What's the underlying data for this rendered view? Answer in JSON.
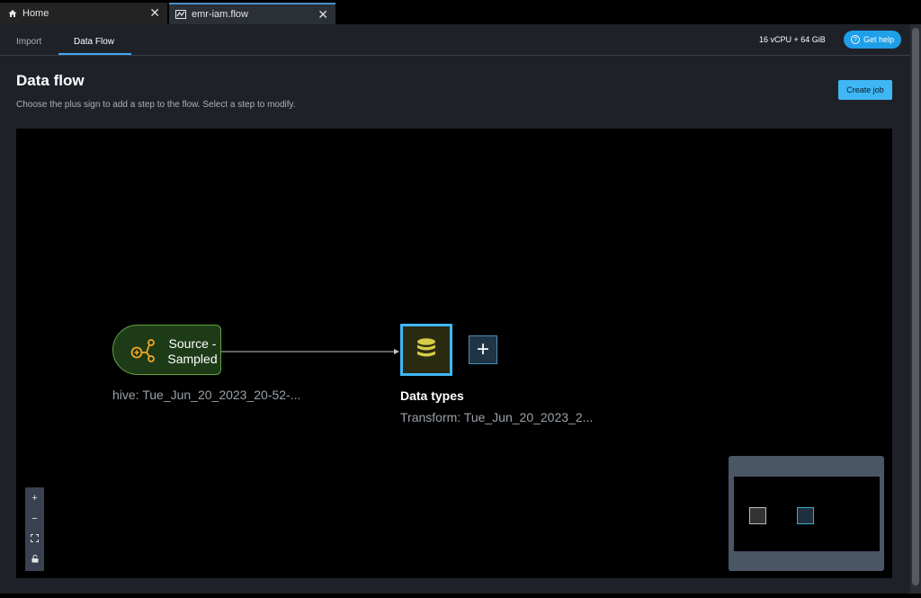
{
  "tabs": [
    {
      "label": "Home",
      "icon": "home-icon"
    },
    {
      "label": "emr-iam.flow",
      "icon": "flow-icon"
    }
  ],
  "subtabs": [
    "Import",
    "Data Flow"
  ],
  "header": {
    "resources": "16 vCPU + 64 GiB",
    "help_label": "Get help"
  },
  "page": {
    "title": "Data flow",
    "description": "Choose the plus sign to add a step to the flow. Select a step to modify.",
    "create_job_label": "Create job"
  },
  "flow": {
    "source": {
      "label": "Source - Sampled",
      "subtitle": "hive: Tue_Jun_20_2023_20-52-..."
    },
    "transform": {
      "title": "Data types",
      "subtitle": "Transform: Tue_Jun_20_2023_2..."
    },
    "add_step": "+"
  },
  "zoom_controls": {
    "zoom_in": "+",
    "zoom_out": "−"
  },
  "colors": {
    "accent": "#3fb7f5",
    "source_border": "#5fa33e",
    "source_fill": "#1e3b18",
    "source_icon": "#f5a623",
    "transform_icon": "#d4cc4a"
  }
}
